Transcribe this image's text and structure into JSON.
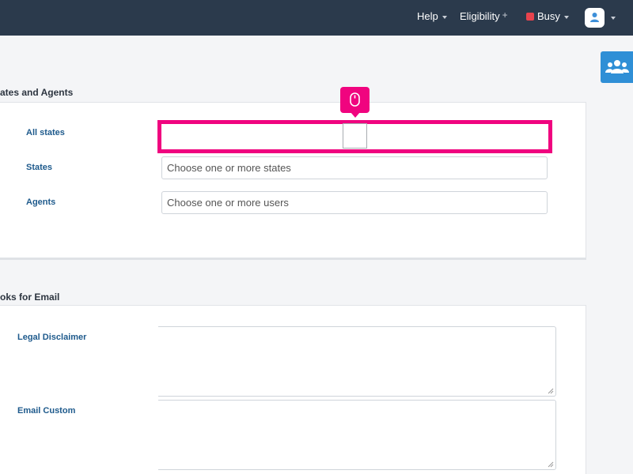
{
  "topbar": {
    "help_label": "Help",
    "eligibility_label": "Eligibility",
    "eligibility_plus": "+",
    "busy_label": "Busy",
    "busy_color": "#e8434d",
    "avatar_icon": "user-icon"
  },
  "side_button": {
    "icon": "group-users-icon",
    "color": "#2f8fd6"
  },
  "states_agents": {
    "title": "ates and Agents",
    "all_states_label": "All states",
    "states_label": "States",
    "states_placeholder": "Choose one or more states",
    "agents_label": "Agents",
    "agents_placeholder": "Choose one or more users"
  },
  "email_hooks": {
    "title": "oks for Email",
    "legal_label": "Legal Disclaimer",
    "custom_label": "Email Custom"
  },
  "highlight": {
    "color": "#f0047f",
    "icon": "mouse-click-icon"
  }
}
